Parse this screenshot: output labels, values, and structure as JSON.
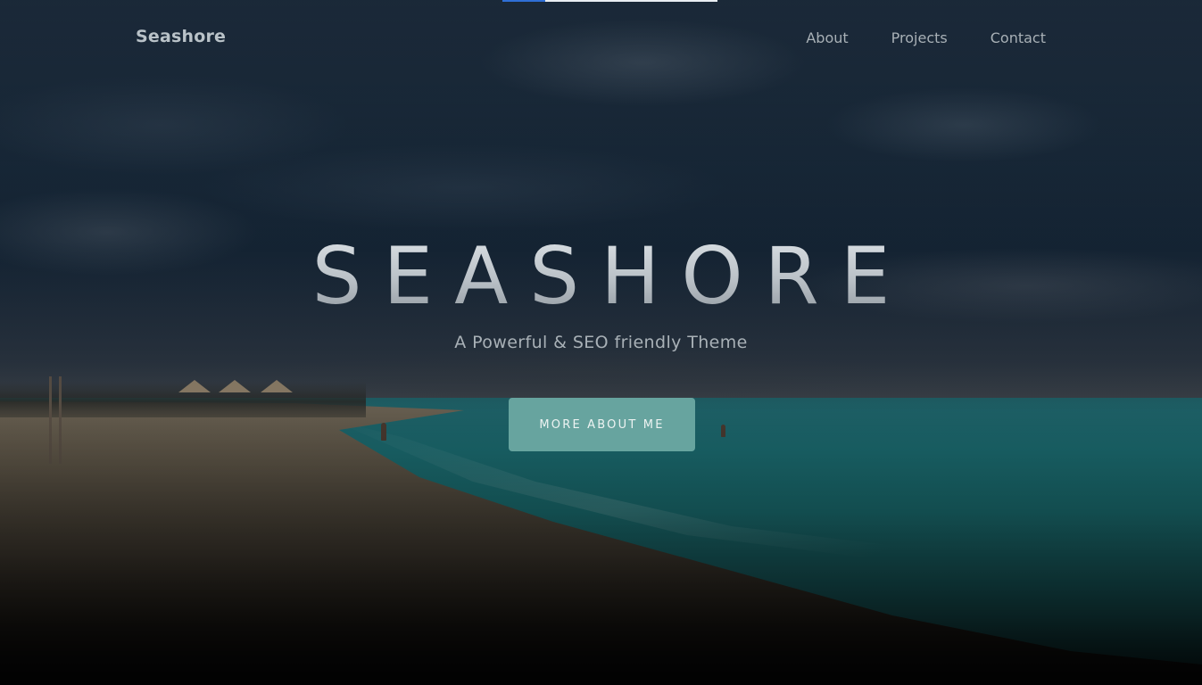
{
  "header": {
    "brand": "Seashore",
    "nav": {
      "items": [
        "About",
        "Projects",
        "Contact"
      ]
    }
  },
  "hero": {
    "title": "SEASHORE",
    "subtitle": "A Powerful & SEO friendly Theme",
    "cta_label": "MORE ABOUT ME"
  },
  "theme": {
    "accent": "#67a49f",
    "loading_bar": "#e9eef2",
    "loading_bar_accent": "#2f6fd6"
  }
}
